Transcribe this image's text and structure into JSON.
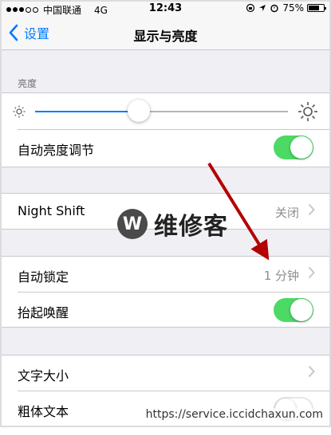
{
  "status_bar": {
    "carrier": "中国联通",
    "network": "4G",
    "time": "12:43",
    "battery_text": "75%",
    "battery_level": 0.75
  },
  "nav": {
    "back_label": "设置",
    "title": "显示与亮度"
  },
  "brightness": {
    "header": "亮度",
    "level": 0.41,
    "auto_label": "自动亮度调节",
    "auto_on": true
  },
  "night_shift": {
    "label": "Night Shift",
    "value": "关闭"
  },
  "auto_lock": {
    "label": "自动锁定",
    "value": "1 分钟"
  },
  "raise_to_wake": {
    "label": "抬起唤醒",
    "on": true
  },
  "text_size": {
    "label": "文字大小"
  },
  "bold_text": {
    "label": "粗体文本",
    "on": false
  },
  "watermark": {
    "badge": "W",
    "text": "维修客",
    "url": "https://service.iccidchaxun.com"
  },
  "colors": {
    "accent": "#007aff",
    "switch_on": "#4cd964",
    "annotation_arrow": "#b40000"
  }
}
